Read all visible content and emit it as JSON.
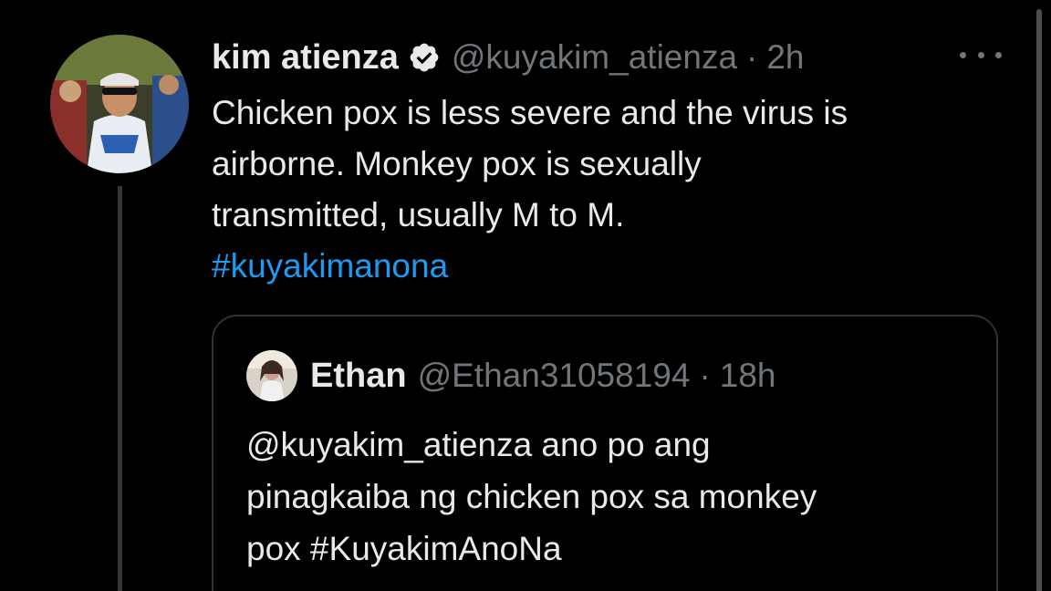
{
  "tweet": {
    "display_name": "kim atienza",
    "handle": "@kuyakim_atienza",
    "separator": "·",
    "time": "2h",
    "text_lines": [
      "Chicken pox is less severe and the virus is",
      "airborne. Monkey pox is sexually",
      "transmitted, usually M to M."
    ],
    "hashtag": "#kuyakimanona",
    "verified_icon": "verified-badge-icon",
    "more_icon": "more-options-icon"
  },
  "quoted_tweet": {
    "display_name": "Ethan",
    "handle": "@Ethan31058194",
    "separator": "·",
    "time": "18h",
    "text_lines": [
      "@kuyakim_atienza ano po ang",
      "pinagkaiba ng chicken pox sa monkey",
      "pox #KuyakimAnoNa"
    ]
  },
  "colors": {
    "background": "#000000",
    "text": "#e7e9ea",
    "secondary_text": "#71767b",
    "link": "#1d9bf0",
    "border": "#2f3336"
  }
}
